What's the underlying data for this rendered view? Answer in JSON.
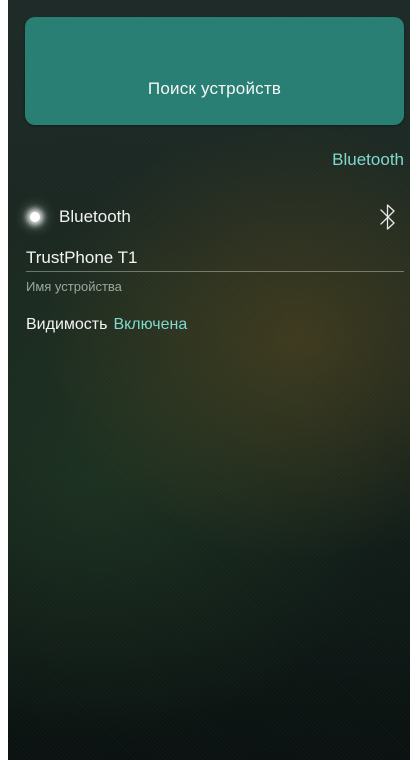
{
  "scan_button": {
    "label": "Поиск устройств"
  },
  "section": {
    "title": "Bluetooth"
  },
  "bluetooth": {
    "label": "Bluetooth",
    "icon": "bluetooth-icon",
    "enabled": true
  },
  "device": {
    "name": "TrustPhone T1",
    "caption": "Имя устройства"
  },
  "visibility": {
    "label": "Видимость",
    "value": "Включена"
  },
  "colors": {
    "accent": "#7fd9cd",
    "button": "#2a7f74"
  }
}
